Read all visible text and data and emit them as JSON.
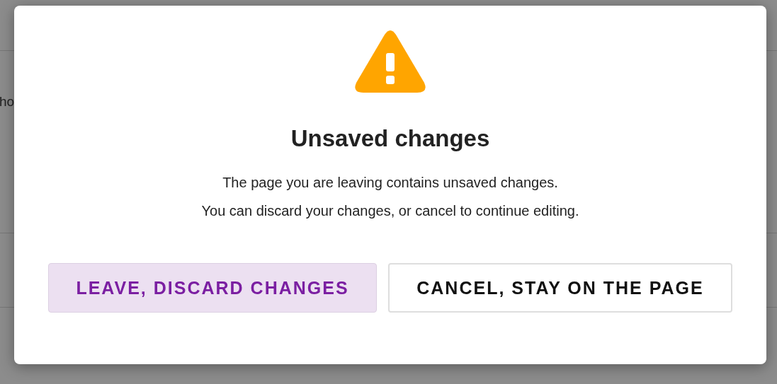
{
  "backdrop": {
    "text": "ho"
  },
  "dialog": {
    "title": "Unsaved changes",
    "message": [
      "The page you are leaving contains unsaved changes.",
      "You can discard your changes, or cancel to continue editing."
    ],
    "buttons": [
      {
        "label": "LEAVE, DISCARD CHANGES",
        "kind": "primary"
      },
      {
        "label": "CANCEL, STAY ON THE PAGE",
        "kind": "outline"
      }
    ]
  }
}
